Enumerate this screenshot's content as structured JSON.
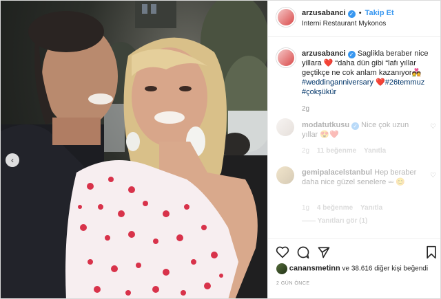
{
  "post": {
    "username": "arzusabanci",
    "follow_label": "Takip Et",
    "separator": "•",
    "location": "Interni Restaurant Mykonos"
  },
  "caption": {
    "username": "arzusabanci",
    "text_1": " Saglikla beraber nice yillara ",
    "text_2": " “daha dün gibi “lafı yıllar geçtikçe ne cok anlam kazanıyor",
    "tag_1": "#weddinganniversary",
    "tag_2": "#26temmuz",
    "tag_3": "#çokşükür",
    "time": "2g"
  },
  "comments": [
    {
      "username": "modatutkusu",
      "text": " Nice çok uzun yıllar",
      "time": "2g",
      "likes": "11 beğenme",
      "reply": "Yanıtla"
    },
    {
      "username": "gemipalacelstanbul",
      "text": " Hep beraber daha nice güzel senelere",
      "time": "1g",
      "likes": "4 beğenme",
      "reply": "Yanıtla",
      "view_replies": "—— Yanıtları gör (1)"
    }
  ],
  "footer": {
    "liker": "canansmetinn",
    "likes_text": " ve 38.616 diğer kişi beğendi",
    "timestamp": "2 GÜN ÖNCE"
  },
  "icons": {
    "like": "heart-icon",
    "comment": "comment-icon",
    "share": "share-icon",
    "save": "bookmark-icon",
    "prev": "chevron-left-icon"
  },
  "colors": {
    "accent": "#3897f0",
    "hashtag": "#003569",
    "heart_emoji": "#c8102e"
  }
}
